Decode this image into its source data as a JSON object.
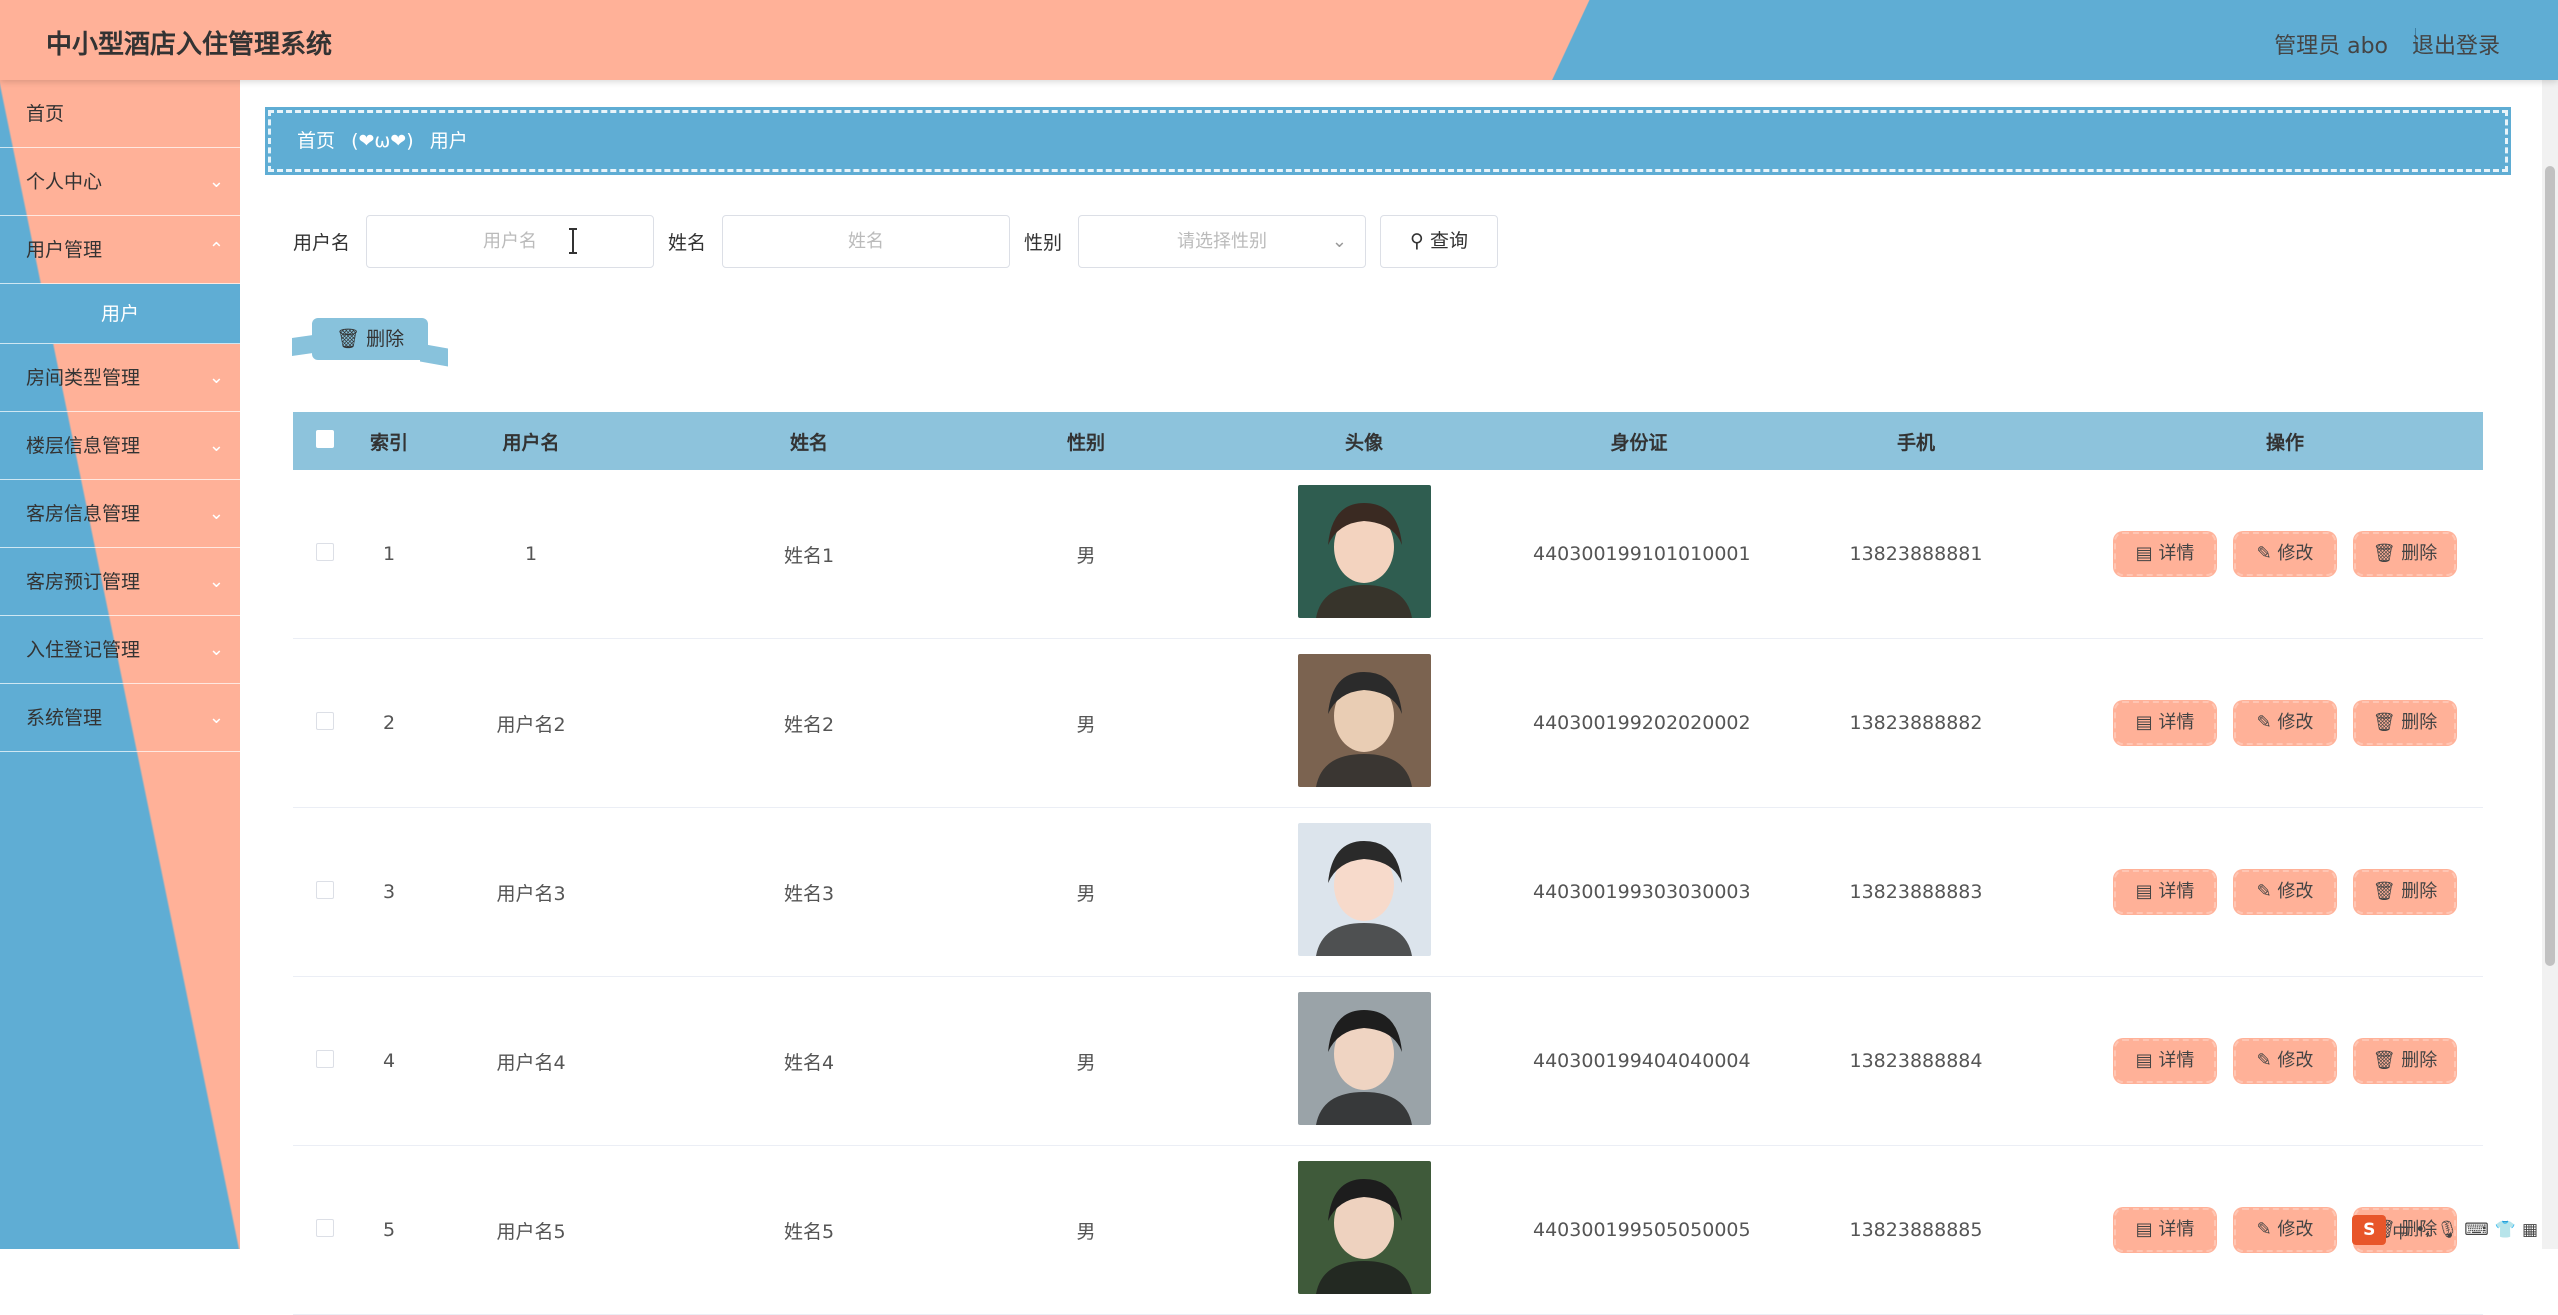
{
  "header": {
    "title": "中小型酒店入住管理系统",
    "user": "管理员 abo",
    "logout": "退出登录"
  },
  "sidebar": {
    "items": [
      {
        "label": "首页"
      },
      {
        "label": "个人中心"
      },
      {
        "label": "用户管理"
      },
      {
        "label": "用户"
      },
      {
        "label": "房间类型管理"
      },
      {
        "label": "楼层信息管理"
      },
      {
        "label": "客房信息管理"
      },
      {
        "label": "客房预订管理"
      },
      {
        "label": "入住登记管理"
      },
      {
        "label": "系统管理"
      }
    ]
  },
  "breadcrumb": {
    "home": "首页",
    "separator": "(❤ω❤)",
    "current": "用户"
  },
  "search": {
    "username_label": "用户名",
    "username_placeholder": "用户名",
    "name_label": "姓名",
    "name_placeholder": "姓名",
    "sex_label": "性别",
    "sex_placeholder": "请选择性别",
    "search_button": "查询"
  },
  "actions": {
    "batch_delete": "删除"
  },
  "table": {
    "columns": [
      "索引",
      "用户名",
      "姓名",
      "性别",
      "头像",
      "身份证",
      "手机",
      "操作"
    ],
    "rows": [
      {
        "index": "1",
        "username": "1",
        "name": "姓名1",
        "sex": "男",
        "id_card": "440300199101010001",
        "phone": "13823888881"
      },
      {
        "index": "2",
        "username": "用户名2",
        "name": "姓名2",
        "sex": "男",
        "id_card": "440300199202020002",
        "phone": "13823888882"
      },
      {
        "index": "3",
        "username": "用户名3",
        "name": "姓名3",
        "sex": "男",
        "id_card": "440300199303030003",
        "phone": "13823888883"
      },
      {
        "index": "4",
        "username": "用户名4",
        "name": "姓名4",
        "sex": "男",
        "id_card": "440300199404040004",
        "phone": "13823888884"
      },
      {
        "index": "5",
        "username": "用户名5",
        "name": "姓名5",
        "sex": "男",
        "id_card": "440300199505050005",
        "phone": "13823888885"
      }
    ],
    "row_actions": {
      "detail": "详情",
      "edit": "修改",
      "delete": "删除"
    }
  },
  "ime": {
    "logo": "S",
    "text": "中"
  },
  "colors": {
    "accent_blue": "#5fadd4",
    "accent_peach": "#ffb198",
    "table_header": "#8dc3dc"
  }
}
